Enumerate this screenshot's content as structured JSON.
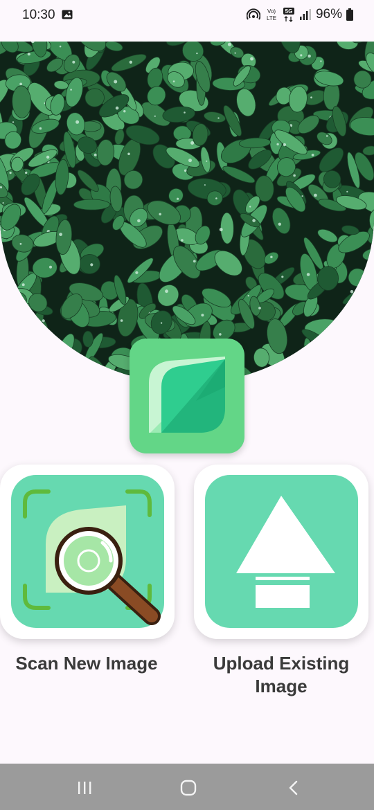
{
  "status_bar": {
    "time": "10:30",
    "network": "5G",
    "lte_label": "Vo) LTE",
    "battery": "96%",
    "icons": [
      "gallery-icon",
      "hotspot-icon",
      "volte-icon",
      "5g-icon",
      "signal-icon",
      "battery-icon"
    ]
  },
  "actions": {
    "scan_label": "Scan New Image",
    "upload_label": "Upload Existing Image"
  },
  "nav": {
    "icons": [
      "recents-icon",
      "home-icon",
      "back-icon"
    ]
  },
  "colors": {
    "background": "#fdf8fd",
    "logo_green": "#63d687",
    "card_mint": "#66d9b0",
    "label_text": "#3a3a3a",
    "nav_bar": "#9b9b9b"
  }
}
